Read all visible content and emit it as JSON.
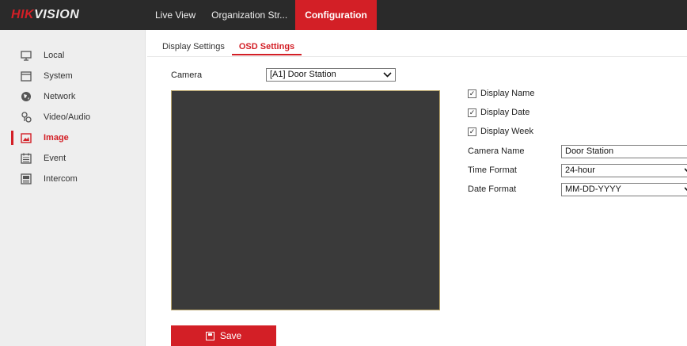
{
  "brand": {
    "logo_red": "HIK",
    "logo_white": "VISION",
    "accent": "#d31f26"
  },
  "topnav": [
    {
      "label": "Live View",
      "active": false
    },
    {
      "label": "Organization Str...",
      "active": false
    },
    {
      "label": "Configuration",
      "active": true
    }
  ],
  "sidebar": {
    "items": [
      {
        "label": "Local",
        "icon": "monitor-icon",
        "active": false
      },
      {
        "label": "System",
        "icon": "system-icon",
        "active": false
      },
      {
        "label": "Network",
        "icon": "globe-icon",
        "active": false
      },
      {
        "label": "Video/Audio",
        "icon": "video-audio-icon",
        "active": false
      },
      {
        "label": "Image",
        "icon": "image-icon",
        "active": true
      },
      {
        "label": "Event",
        "icon": "calendar-icon",
        "active": false
      },
      {
        "label": "Intercom",
        "icon": "intercom-icon",
        "active": false
      }
    ]
  },
  "tabs": [
    {
      "label": "Display Settings",
      "active": false
    },
    {
      "label": "OSD Settings",
      "active": true
    }
  ],
  "camera": {
    "label": "Camera",
    "value": "[A1] Door Station"
  },
  "osd": {
    "display_name": {
      "label": "Display Name",
      "checked": true
    },
    "display_date": {
      "label": "Display Date",
      "checked": true
    },
    "display_week": {
      "label": "Display Week",
      "checked": true
    },
    "camera_name": {
      "label": "Camera Name",
      "value": "Door Station"
    },
    "time_format": {
      "label": "Time Format",
      "value": "24-hour"
    },
    "date_format": {
      "label": "Date Format",
      "value": "MM-DD-YYYY"
    }
  },
  "save_label": "Save"
}
